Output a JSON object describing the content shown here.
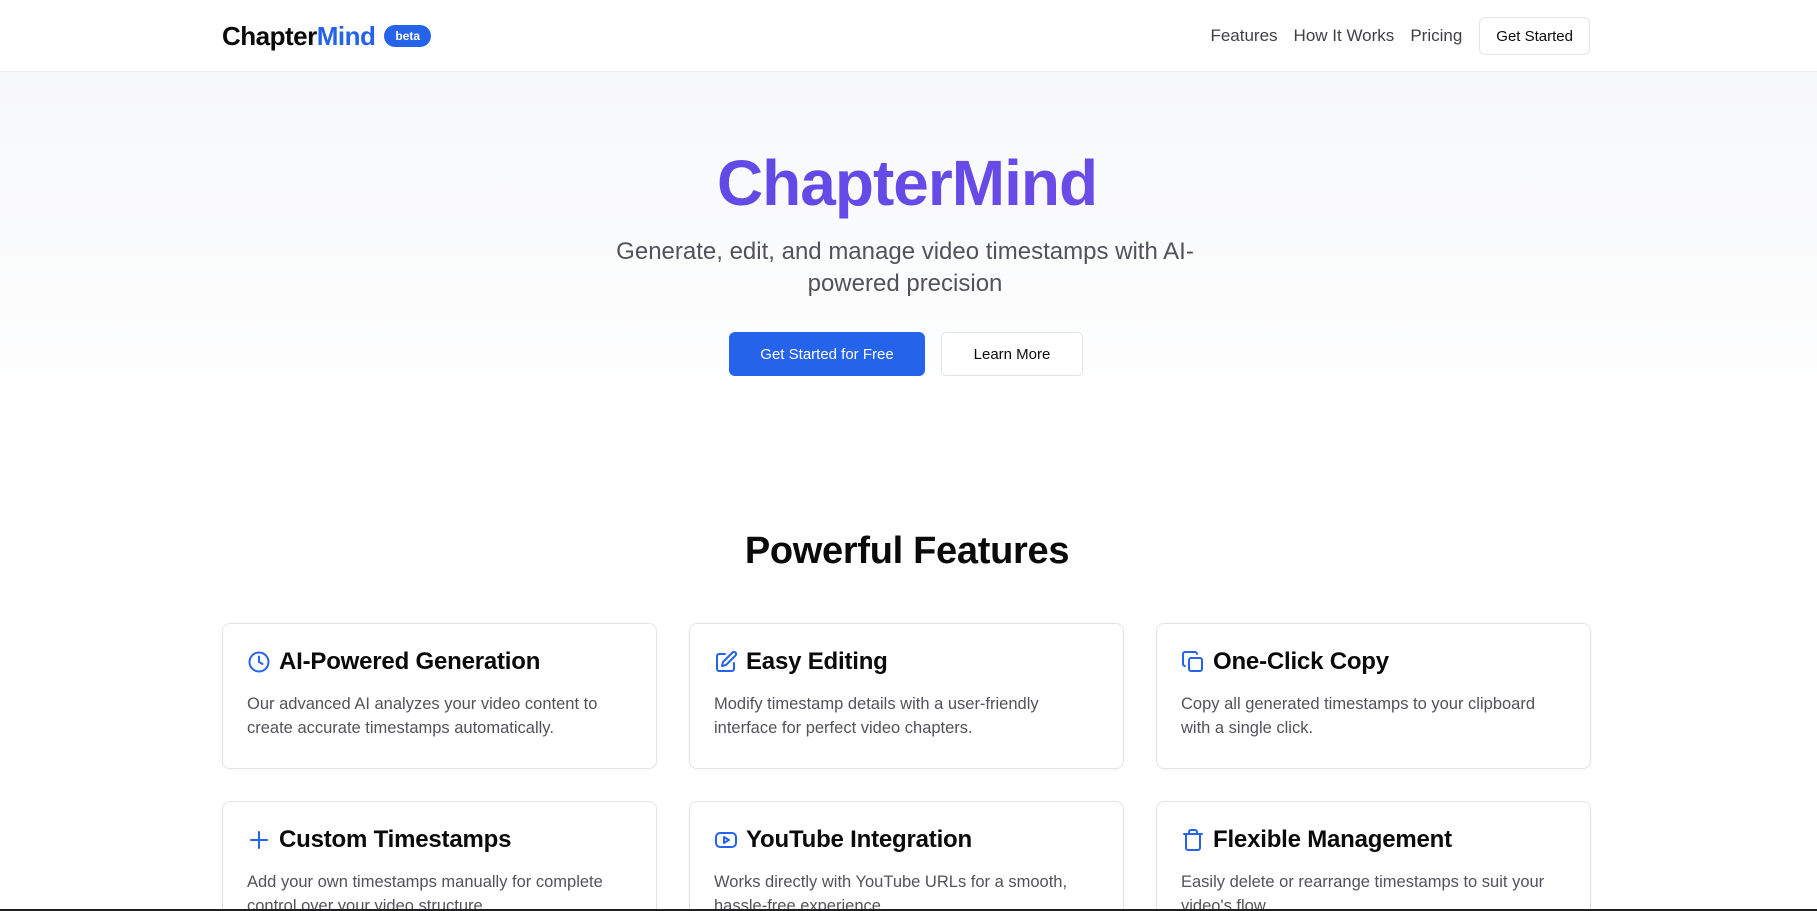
{
  "brand": {
    "name_main": "Chapter",
    "name_accent": "Mind",
    "badge": "beta"
  },
  "nav": {
    "links": [
      "Features",
      "How It Works",
      "Pricing"
    ],
    "cta": "Get Started"
  },
  "hero": {
    "title": "ChapterMind",
    "subtitle": "Generate, edit, and manage video timestamps with AI-powered precision",
    "primary_button": "Get Started for Free",
    "secondary_button": "Learn More"
  },
  "features": {
    "title": "Powerful Features",
    "items": [
      {
        "icon": "clock-icon",
        "title": "AI-Powered Generation",
        "description": "Our advanced AI analyzes your video content to create accurate timestamps automatically."
      },
      {
        "icon": "edit-icon",
        "title": "Easy Editing",
        "description": "Modify timestamp details with a user-friendly interface for perfect video chapters."
      },
      {
        "icon": "copy-icon",
        "title": "One-Click Copy",
        "description": "Copy all generated timestamps to your clipboard with a single click."
      },
      {
        "icon": "plus-icon",
        "title": "Custom Timestamps",
        "description": "Add your own timestamps manually for complete control over your video structure."
      },
      {
        "icon": "youtube-icon",
        "title": "YouTube Integration",
        "description": "Works directly with YouTube URLs for a smooth, hassle-free experience."
      },
      {
        "icon": "trash-icon",
        "title": "Flexible Management",
        "description": "Easily delete or rearrange timestamps to suit your video's flow."
      }
    ]
  },
  "colors": {
    "accent": "#2563eb",
    "hero_gradient_start": "#4f46e5",
    "hero_gradient_end": "#7c4fe8",
    "text_muted": "#52525b",
    "border": "#e4e4e7"
  }
}
